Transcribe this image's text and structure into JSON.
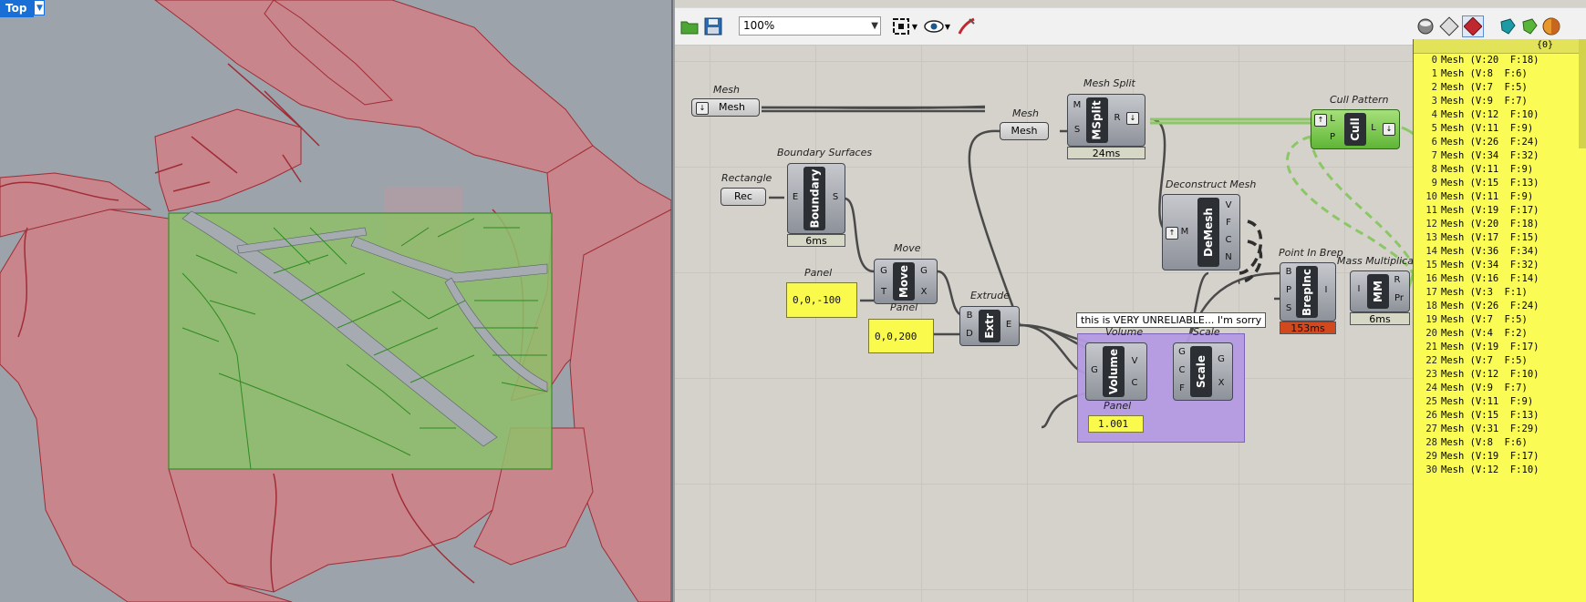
{
  "viewport": {
    "name": "Top"
  },
  "toolbar": {
    "zoom": "100%"
  },
  "components": {
    "mesh_param": {
      "title": "Mesh",
      "label": "Mesh"
    },
    "mesh_param2": {
      "title": "Mesh",
      "label": "Mesh"
    },
    "rectangle": {
      "title": "Rectangle",
      "label": "Rec"
    },
    "boundary": {
      "title": "Boundary Surfaces",
      "core": "Boundary",
      "in": "E",
      "out": "S",
      "timer": "6ms"
    },
    "move": {
      "title": "Move",
      "core": "Move",
      "in1": "G",
      "in2": "T",
      "out1": "G",
      "out2": "X"
    },
    "panel1": {
      "title": "Panel",
      "value": "0,0,-100"
    },
    "panel2": {
      "title": "Panel",
      "value": "0,0,200"
    },
    "extrude": {
      "title": "Extrude",
      "core": "Extr",
      "in1": "B",
      "in2": "D",
      "out": "E"
    },
    "mesh_split": {
      "title": "Mesh Split",
      "core": "MSplit",
      "in1": "M",
      "in2": "S",
      "out": "R",
      "timer": "24ms"
    },
    "deconstruct": {
      "title": "Deconstruct Mesh",
      "core": "DeMesh",
      "in": "M",
      "o1": "V",
      "o2": "F",
      "o3": "C",
      "o4": "N"
    },
    "cull": {
      "title": "Cull Pattern",
      "core": "Cull",
      "in1": "L",
      "in2": "P",
      "out": "L"
    },
    "point_in_brep": {
      "title": "Point In Brep",
      "core": "BrepInc",
      "i1": "B",
      "i2": "P",
      "i3": "S",
      "out": "I",
      "timer": "153ms"
    },
    "mass_mult": {
      "title": "Mass Multiplication",
      "core": "MM",
      "in": "I",
      "o1": "R",
      "o2": "Pr",
      "timer": "6ms"
    },
    "volume": {
      "title": "Volume",
      "core": "Volume",
      "in": "G",
      "o1": "V",
      "o2": "C"
    },
    "scale": {
      "title": "Scale",
      "core": "Scale",
      "i1": "G",
      "i2": "C",
      "i3": "F",
      "o1": "G",
      "o2": "X"
    },
    "panel3": {
      "title": "Panel",
      "value": "1.001"
    },
    "tooltip": "this is VERY UNRELIABLE... I'm sorry"
  },
  "list": {
    "header": "{0}",
    "rows": [
      {
        "i": "0",
        "t": "Mesh (V:20  F:18)"
      },
      {
        "i": "1",
        "t": "Mesh (V:8  F:6)"
      },
      {
        "i": "2",
        "t": "Mesh (V:7  F:5)"
      },
      {
        "i": "3",
        "t": "Mesh (V:9  F:7)"
      },
      {
        "i": "4",
        "t": "Mesh (V:12  F:10)"
      },
      {
        "i": "5",
        "t": "Mesh (V:11  F:9)"
      },
      {
        "i": "6",
        "t": "Mesh (V:26  F:24)"
      },
      {
        "i": "7",
        "t": "Mesh (V:34  F:32)"
      },
      {
        "i": "8",
        "t": "Mesh (V:11  F:9)"
      },
      {
        "i": "9",
        "t": "Mesh (V:15  F:13)"
      },
      {
        "i": "10",
        "t": "Mesh (V:11  F:9)"
      },
      {
        "i": "11",
        "t": "Mesh (V:19  F:17)"
      },
      {
        "i": "12",
        "t": "Mesh (V:20  F:18)"
      },
      {
        "i": "13",
        "t": "Mesh (V:17  F:15)"
      },
      {
        "i": "14",
        "t": "Mesh (V:36  F:34)"
      },
      {
        "i": "15",
        "t": "Mesh (V:34  F:32)"
      },
      {
        "i": "16",
        "t": "Mesh (V:16  F:14)"
      },
      {
        "i": "17",
        "t": "Mesh (V:3  F:1)"
      },
      {
        "i": "18",
        "t": "Mesh (V:26  F:24)"
      },
      {
        "i": "19",
        "t": "Mesh (V:7  F:5)"
      },
      {
        "i": "20",
        "t": "Mesh (V:4  F:2)"
      },
      {
        "i": "21",
        "t": "Mesh (V:19  F:17)"
      },
      {
        "i": "22",
        "t": "Mesh (V:7  F:5)"
      },
      {
        "i": "23",
        "t": "Mesh (V:12  F:10)"
      },
      {
        "i": "24",
        "t": "Mesh (V:9  F:7)"
      },
      {
        "i": "25",
        "t": "Mesh (V:11  F:9)"
      },
      {
        "i": "26",
        "t": "Mesh (V:15  F:13)"
      },
      {
        "i": "27",
        "t": "Mesh (V:31  F:29)"
      },
      {
        "i": "28",
        "t": "Mesh (V:8  F:6)"
      },
      {
        "i": "29",
        "t": "Mesh (V:19  F:17)"
      },
      {
        "i": "30",
        "t": "Mesh (V:12  F:10)"
      }
    ]
  }
}
